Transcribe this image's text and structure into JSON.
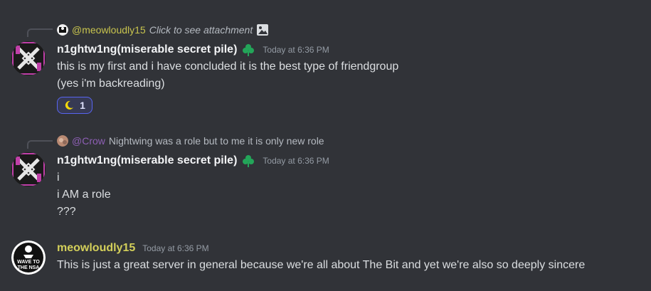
{
  "messages": [
    {
      "reply": {
        "author": "@meowloudly15",
        "text": "Click to see attachment",
        "attachment_icon": "image-icon",
        "author_color": "#c8c44e"
      },
      "author": "n1ghtw1ng(miserable secret pile)",
      "badge_icon": "clover-icon",
      "timestamp": "Today at 6:36 PM",
      "lines": [
        "this is my first and i have concluded it is the best type of friendgroup",
        "(yes i'm backreading)"
      ],
      "reaction": {
        "emoji": "crescent-moon-icon",
        "count": "1"
      }
    },
    {
      "reply": {
        "author": "@Crow",
        "text": "Nightwing was a role but to me it is only new role",
        "author_color": "#8e5fb5"
      },
      "author": "n1ghtw1ng(miserable secret pile)",
      "badge_icon": "clover-icon",
      "timestamp": "Today at 6:36 PM",
      "lines": [
        "i",
        "i AM a role",
        "???"
      ]
    },
    {
      "author": "meowloudly15",
      "author_color": "#d3cf5a",
      "avatar_text": [
        "WAVE TO",
        "THE NSA"
      ],
      "timestamp": "Today at 6:36 PM",
      "lines": [
        "This is just a great server in general because we're all about The Bit and yet we're also so deeply sincere"
      ]
    }
  ]
}
